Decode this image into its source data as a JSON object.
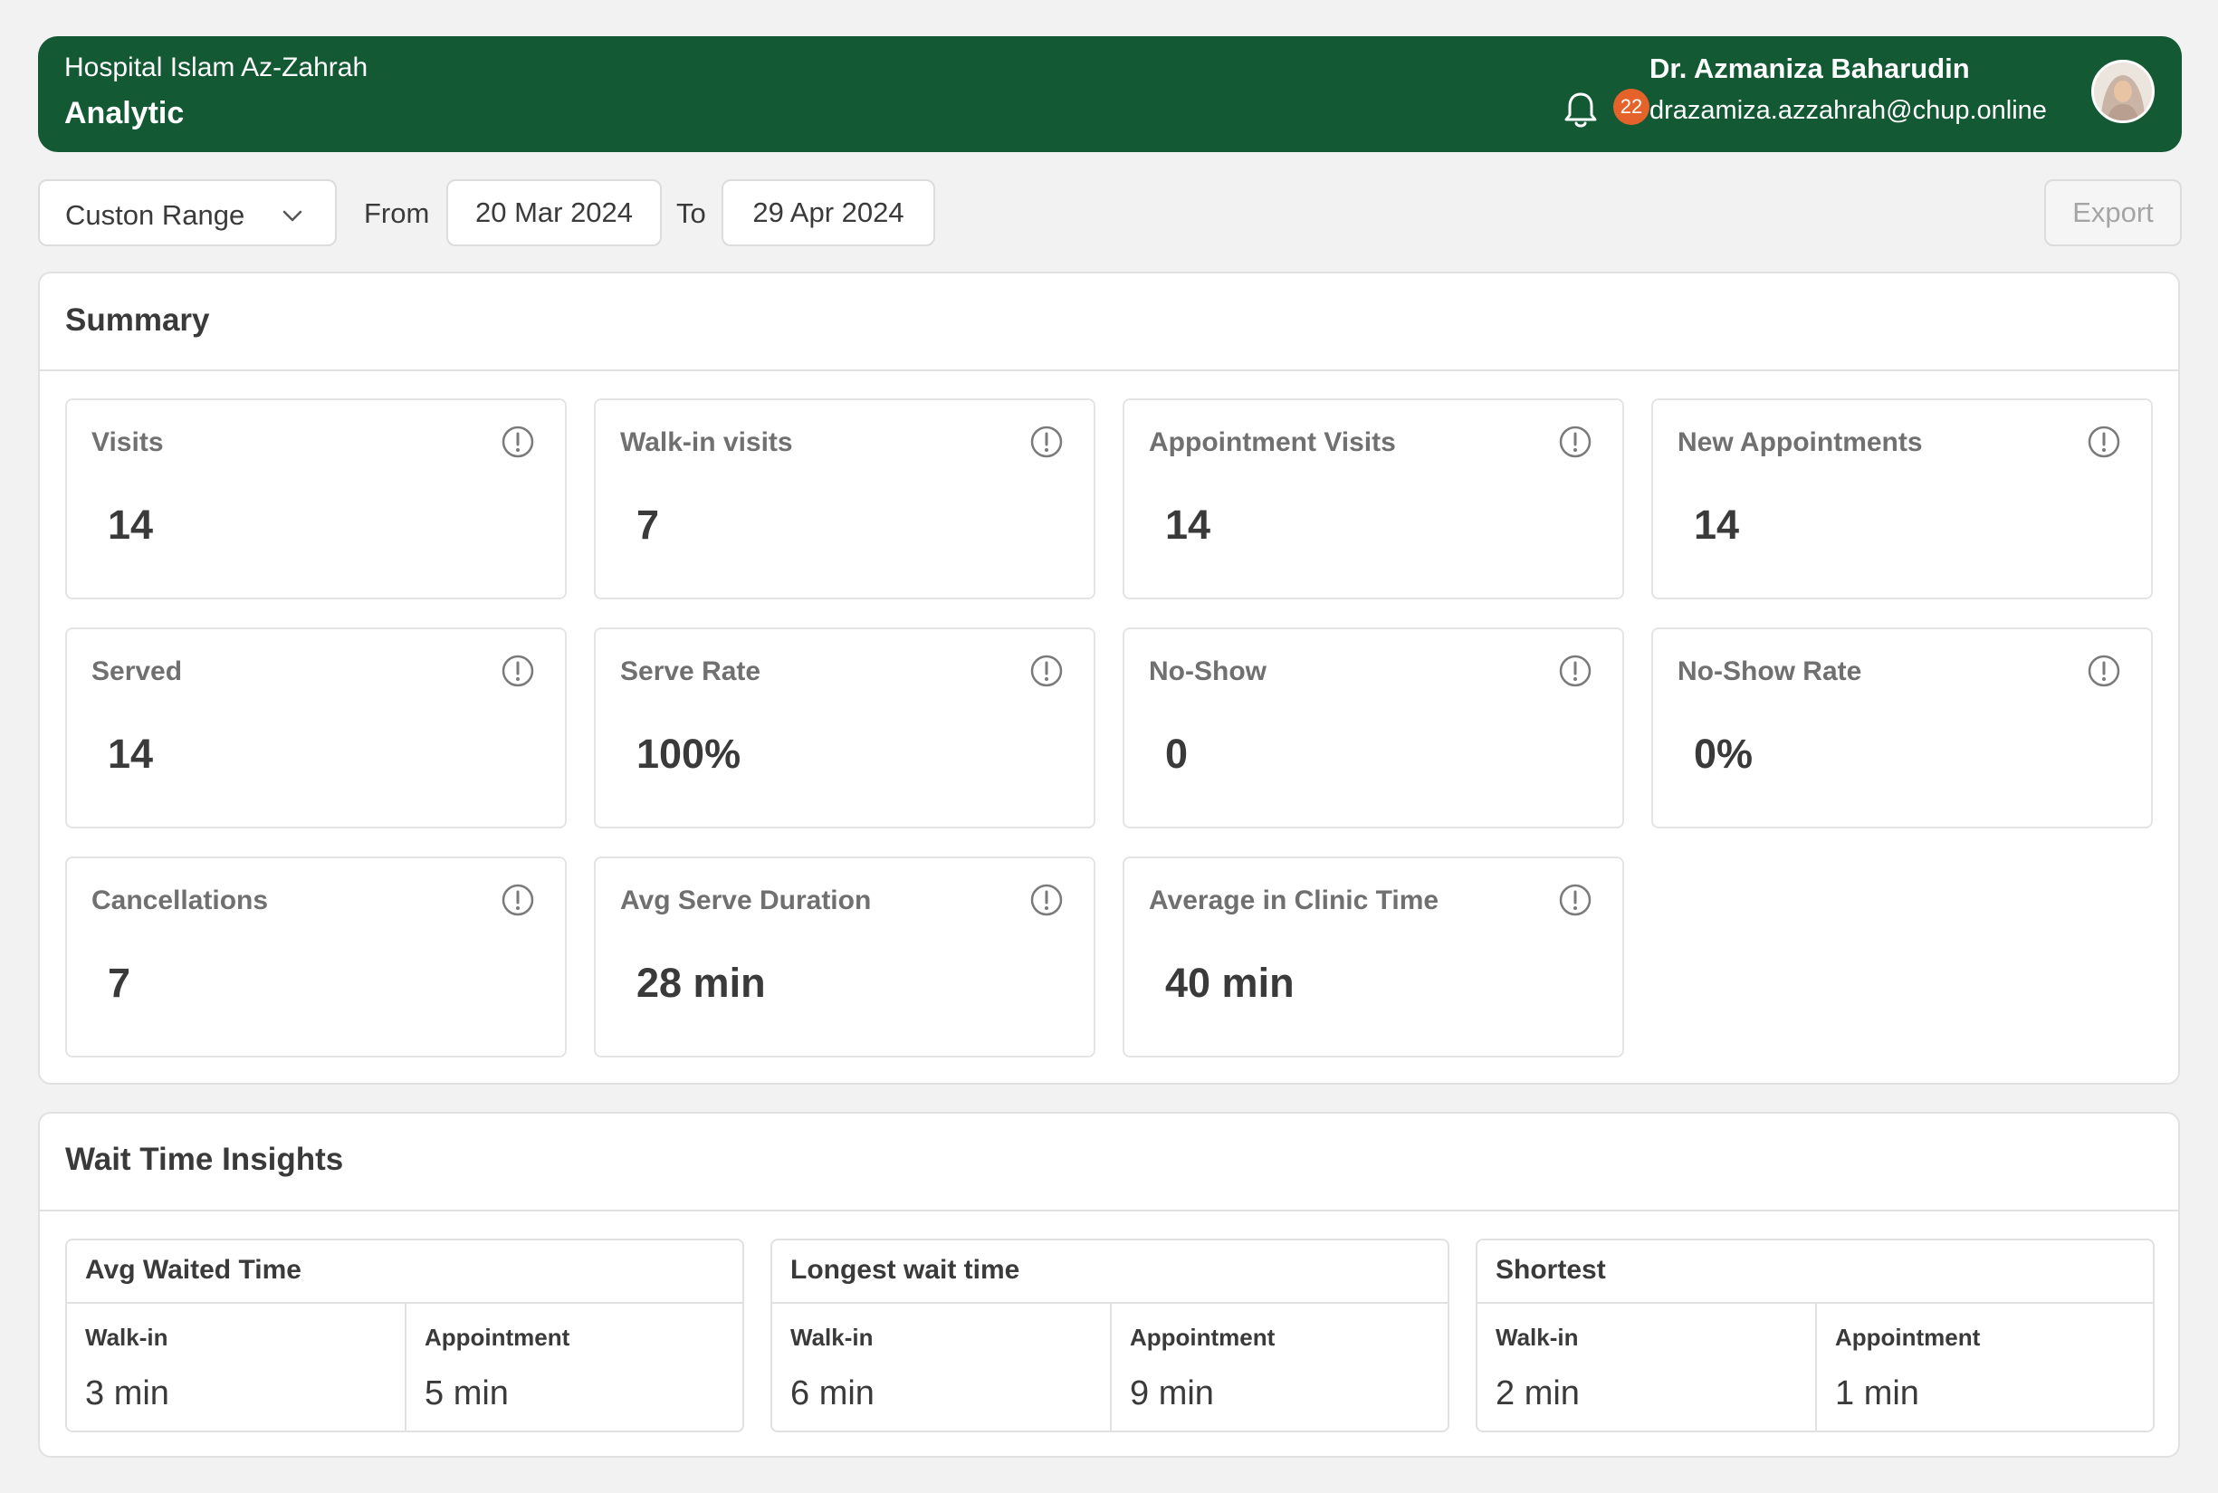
{
  "header": {
    "hospital": "Hospital Islam Az-Zahrah",
    "title": "Analytic",
    "notification_count": "22",
    "user_name": "Dr. Azmaniza Baharudin",
    "user_email": "drazamiza.azzahrah@chup.online"
  },
  "toolbar": {
    "range_label": "Custon Range",
    "from_label": "From",
    "from_date": "20 Mar 2024",
    "to_label": "To",
    "to_date": "29 Apr 2024",
    "export_label": "Export"
  },
  "summary": {
    "title": "Summary",
    "metrics": [
      {
        "label": "Visits",
        "value": "14"
      },
      {
        "label": "Walk-in visits",
        "value": "7"
      },
      {
        "label": "Appointment Visits",
        "value": "14"
      },
      {
        "label": "New Appointments",
        "value": "14"
      },
      {
        "label": "Served",
        "value": "14"
      },
      {
        "label": "Serve Rate",
        "value": "100%"
      },
      {
        "label": "No-Show",
        "value": "0"
      },
      {
        "label": "No-Show Rate",
        "value": "0%"
      },
      {
        "label": "Cancellations",
        "value": "7"
      },
      {
        "label": "Avg Serve Duration",
        "value": "28 min"
      },
      {
        "label": "Average in Clinic Time",
        "value": "40 min"
      }
    ]
  },
  "wait": {
    "title": "Wait Time Insights",
    "cards": [
      {
        "title": "Avg Waited Time",
        "walkin_label": "Walk-in",
        "walkin_value": "3 min",
        "appt_label": "Appointment",
        "appt_value": "5 min"
      },
      {
        "title": "Longest wait time",
        "walkin_label": "Walk-in",
        "walkin_value": "6 min",
        "appt_label": "Appointment",
        "appt_value": "9 min"
      },
      {
        "title": "Shortest",
        "walkin_label": "Walk-in",
        "walkin_value": "2 min",
        "appt_label": "Appointment",
        "appt_value": "1 min"
      }
    ]
  },
  "colors": {
    "header_bg": "#135934",
    "badge": "#e5622a",
    "page_bg": "#f2f2f2"
  },
  "icons": [
    "bell-icon",
    "chevron-down-icon",
    "info-icon",
    "avatar"
  ]
}
